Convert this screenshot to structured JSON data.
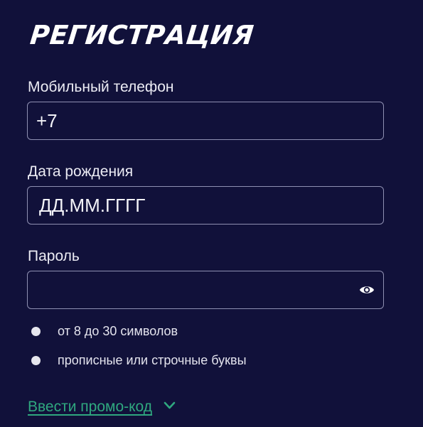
{
  "form": {
    "title": "РЕГИСТРАЦИЯ",
    "phone": {
      "label": "Мобильный телефон",
      "value": "+7"
    },
    "birthdate": {
      "label": "Дата рождения",
      "placeholder": "ДД.ММ.ГГГГ"
    },
    "password": {
      "label": "Пароль",
      "value": "",
      "toggle_icon": "eye-icon",
      "rules": [
        "от 8 до 30 символов",
        "прописные или строчные буквы"
      ]
    },
    "promo": {
      "link_label": "Ввести промо-код",
      "icon": "chevron-down-icon"
    }
  },
  "colors": {
    "background": "#11113a",
    "border": "#8f90b2",
    "text": "#ececf4",
    "accent_green": "#2fa87f"
  }
}
